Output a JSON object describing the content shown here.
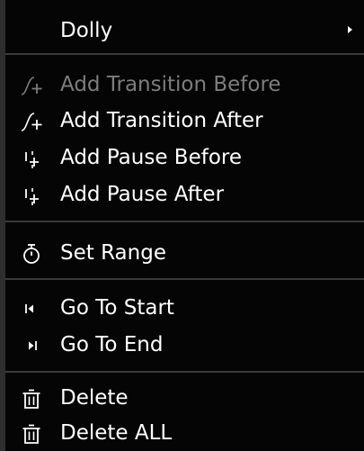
{
  "menu": {
    "header": {
      "label": "Dolly",
      "has_submenu": true,
      "icon": "none"
    },
    "group_transitions": [
      {
        "label": "Add Transition Before",
        "icon": "transition-curve-plus-icon",
        "enabled": false
      },
      {
        "label": "Add Transition After",
        "icon": "transition-curve-plus-icon",
        "enabled": true
      },
      {
        "label": "Add Pause Before",
        "icon": "pause-bar-plus-icon",
        "enabled": true
      },
      {
        "label": "Add Pause After",
        "icon": "pause-bar-plus-icon",
        "enabled": true
      }
    ],
    "group_range": [
      {
        "label": "Set Range",
        "icon": "stopwatch-icon",
        "enabled": true
      }
    ],
    "group_navigation": [
      {
        "label": "Go To Start",
        "icon": "skip-to-start-icon",
        "enabled": true
      },
      {
        "label": "Go To End",
        "icon": "skip-to-end-icon",
        "enabled": true
      }
    ],
    "group_delete": [
      {
        "label": "Delete",
        "icon": "trash-icon",
        "enabled": true
      },
      {
        "label": "Delete ALL",
        "icon": "trash-icon",
        "enabled": true
      }
    ]
  },
  "colors": {
    "background": "#050505",
    "text": "#ffffff",
    "disabled_text": "#7d7d7d",
    "separator": "#3a3a3a"
  }
}
